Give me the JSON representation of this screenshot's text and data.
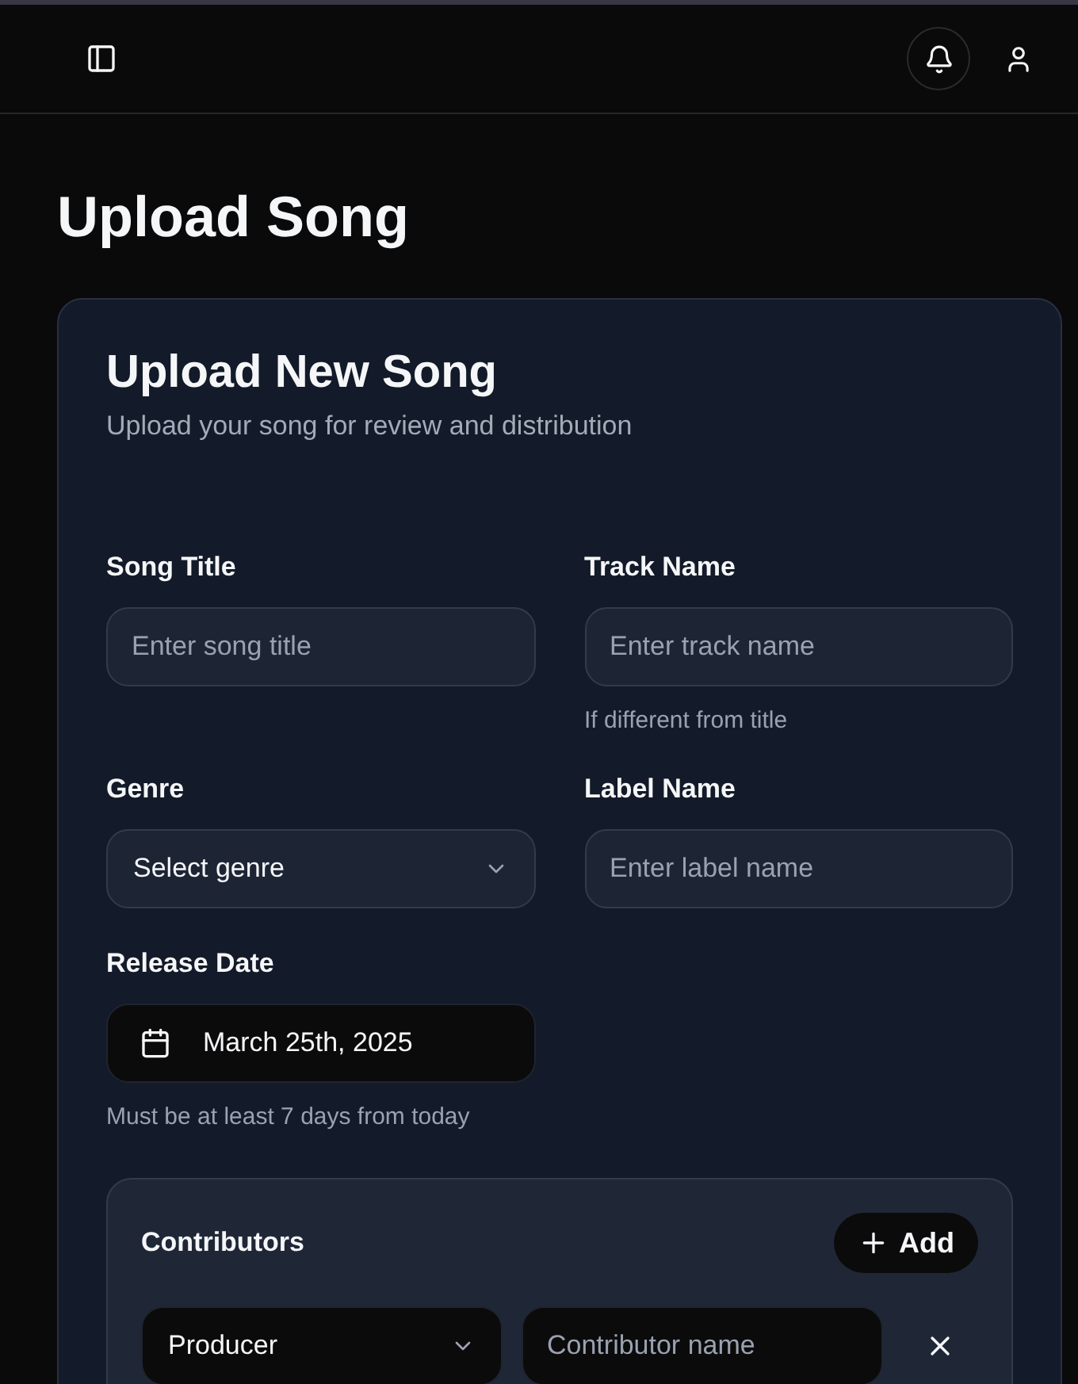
{
  "page_title": "Upload Song",
  "card": {
    "title": "Upload New Song",
    "subtitle": "Upload your song for review and distribution"
  },
  "fields": [
    {
      "kind": "text",
      "label": "Song Title",
      "placeholder": "Enter song title"
    },
    {
      "kind": "text",
      "label": "Track Name",
      "placeholder": "Enter track name",
      "hint": "If different from title"
    },
    {
      "kind": "select",
      "label": "Genre",
      "placeholder": "Select genre"
    },
    {
      "kind": "text",
      "label": "Label Name",
      "placeholder": "Enter label name"
    },
    {
      "kind": "date",
      "label": "Release Date",
      "value": "March 25th, 2025",
      "hint": "Must be at least 7 days from today"
    }
  ],
  "contributors": {
    "title": "Contributors",
    "add_button": "Add",
    "rows": [
      {
        "role": "Producer",
        "placeholder": "Contributor name"
      }
    ]
  }
}
